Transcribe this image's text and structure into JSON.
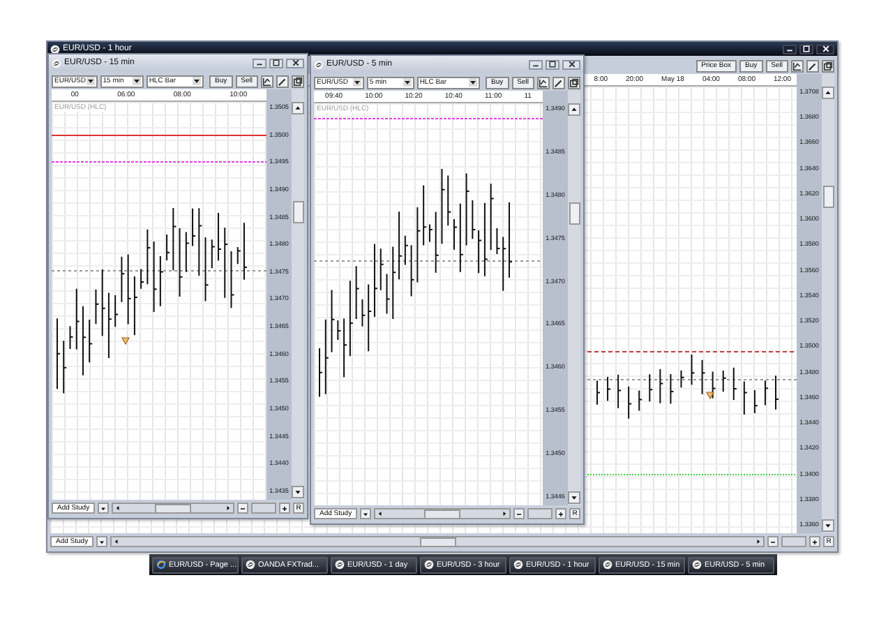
{
  "windows": [
    {
      "kind": "dark",
      "title": "EUR/USD - 1 hour",
      "toolbar_buttons": [
        "Price Box",
        "Buy",
        "Sell"
      ],
      "time_labels": [
        "8:00",
        "20:00",
        "May 18",
        "04:00",
        "08:00",
        "12:00"
      ],
      "price_labels": [
        "1.3708",
        "1.3680",
        "1.3660",
        "1.3640",
        "1.3620",
        "1.3600",
        "1.3580",
        "1.3560",
        "1.3540",
        "1.3520",
        "1.3500",
        "1.3480",
        "1.3460",
        "1.3440",
        "1.3420",
        "1.3400",
        "1.3380",
        "1.3360"
      ],
      "bottom": {
        "add_study": "Add Study",
        "reset": "R"
      }
    },
    {
      "kind": "light",
      "title": "EUR/USD - 15 min",
      "selects": [
        "EUR/USD",
        "15 min",
        "HLC Bar"
      ],
      "toolbar_buttons": [
        "Buy",
        "Sell"
      ],
      "time_labels": [
        "00",
        "06:00",
        "08:00",
        "10:00"
      ],
      "series_label": "EUR/USD (HLC)",
      "price_labels": [
        "1.3505",
        "1.3500",
        "1.3495",
        "1.3490",
        "1.3485",
        "1.3480",
        "1.3475",
        "1.3470",
        "1.3465",
        "1.3460",
        "1.3455",
        "1.3450",
        "1.3445",
        "1.3440",
        "1.3435"
      ],
      "bottom": {
        "add_study": "Add Study",
        "reset": "R"
      }
    },
    {
      "kind": "light",
      "title": "EUR/USD - 5 min",
      "selects": [
        "EUR/USD",
        "5 min",
        "HLC Bar"
      ],
      "toolbar_buttons": [
        "Buy",
        "Sell"
      ],
      "time_labels": [
        "09:40",
        "10:00",
        "10:20",
        "10:40",
        "11:00",
        "11"
      ],
      "series_label": "EUR/USD (HLC)",
      "price_labels": [
        "1.3490",
        "1.3485",
        "1.3480",
        "1.3475",
        "1.3470",
        "1.3465",
        "1.3460",
        "1.3455",
        "1.3450",
        "1.3446"
      ],
      "bottom": {
        "add_study": "Add Study",
        "reset": "R"
      }
    }
  ],
  "taskbar": [
    {
      "kind": "browser",
      "label": "EUR/USD - Page ..."
    },
    {
      "kind": "app",
      "label": "OANDA FXTrad..."
    },
    {
      "kind": "app",
      "label": "EUR/USD - 1 day"
    },
    {
      "kind": "app",
      "label": "EUR/USD - 3 hour"
    },
    {
      "kind": "app",
      "label": "EUR/USD - 1 hour"
    },
    {
      "kind": "app",
      "label": "EUR/USD - 15 min"
    },
    {
      "kind": "app",
      "label": "EUR/USD - 5 min"
    }
  ]
}
